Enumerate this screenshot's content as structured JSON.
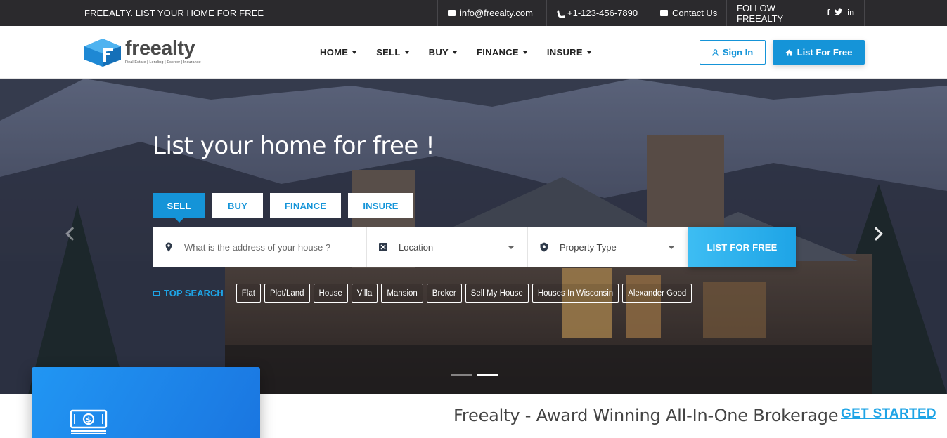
{
  "topbar": {
    "tagline": "FREEALTY. LIST YOUR HOME FOR FREE",
    "email": "info@freealty.com",
    "phone": "+1-123-456-7890",
    "contact": "Contact Us",
    "follow": "FOLLOW FREEALTY",
    "social": [
      "f",
      "t",
      "in"
    ],
    "icons": [
      "email-icon",
      "phone-icon",
      "mail-icon",
      "facebook-icon",
      "twitter-icon",
      "linkedin-icon"
    ]
  },
  "nav": {
    "logo_word": "freealty",
    "logo_sub": "Real Estate | Lending | Escrow | Insurance",
    "menu": [
      "HOME",
      "SELL",
      "BUY",
      "FINANCE",
      "INSURE"
    ],
    "sign_in": "Sign In",
    "list_free": "List For Free"
  },
  "hero": {
    "title": "List your home for free !",
    "tabs": [
      "SELL",
      "BUY",
      "FINANCE",
      "INSURE"
    ],
    "active_tab": "SELL",
    "address_placeholder": "What is the address of your house ?",
    "location": "Location",
    "property_type": "Property Type",
    "search_button": "LIST FOR FREE",
    "top_search_label": "TOP SEARCH",
    "chips": [
      "Flat",
      "Plot/Land",
      "House",
      "Villa",
      "Mansion",
      "Broker",
      "Sell My House",
      "Houses In Wisconsin",
      "Alexander Good"
    ],
    "slides": 2,
    "active_slide": 2
  },
  "bottom": {
    "award": "Freealty - Award Winning All-In-One Brokerage",
    "get_started": "GET STARTED"
  },
  "colors": {
    "accent": "#1594d8",
    "topbar": "#2b2a2d",
    "card": "#2196f3"
  }
}
